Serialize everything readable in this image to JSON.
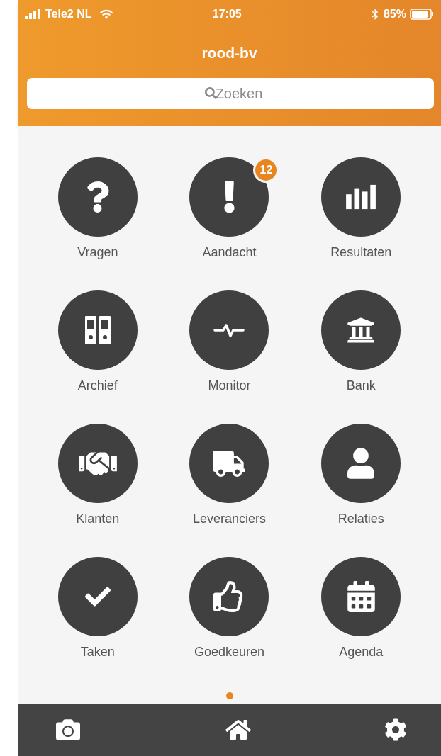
{
  "status_bar": {
    "carrier": "Tele2 NL",
    "time": "17:05",
    "battery": "85%"
  },
  "title": "rood-bv",
  "search": {
    "placeholder": "Zoeken"
  },
  "tiles": [
    {
      "label": "Vragen"
    },
    {
      "label": "Aandacht",
      "badge": "12"
    },
    {
      "label": "Resultaten"
    },
    {
      "label": "Archief"
    },
    {
      "label": "Monitor"
    },
    {
      "label": "Bank"
    },
    {
      "label": "Klanten"
    },
    {
      "label": "Leveranciers"
    },
    {
      "label": "Relaties"
    },
    {
      "label": "Taken"
    },
    {
      "label": "Goedkeuren"
    },
    {
      "label": "Agenda"
    }
  ],
  "pages": [
    {
      "selected": true
    }
  ]
}
